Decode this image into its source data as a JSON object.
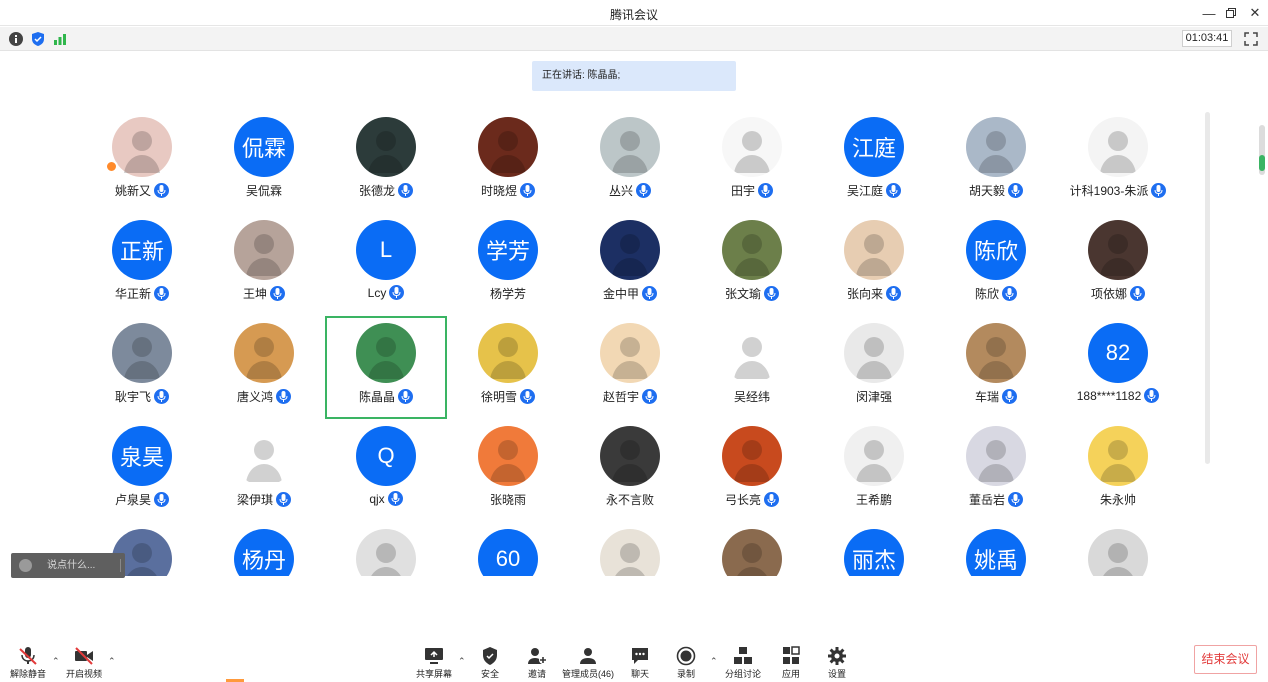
{
  "window": {
    "title": "腾讯会议"
  },
  "infobar": {
    "timer": "01:03:41"
  },
  "speaking": {
    "label": "正在讲话: 陈晶晶;"
  },
  "participants": [
    {
      "name": "姚新又",
      "avatar_text": "",
      "mic": true,
      "color": "#e8c9c2"
    },
    {
      "name": "吴侃霖",
      "avatar_text": "侃霖",
      "mic": false
    },
    {
      "name": "张德龙",
      "avatar_text": "",
      "mic": true,
      "color": "#2c3b3a"
    },
    {
      "name": "时晓煜",
      "avatar_text": "",
      "mic": true,
      "color": "#6b2a1c"
    },
    {
      "name": "丛兴",
      "avatar_text": "",
      "mic": true,
      "color": "#bcc6c8"
    },
    {
      "name": "田宇",
      "avatar_text": "",
      "mic": true,
      "color": "#f7f7f7"
    },
    {
      "name": "吴江庭",
      "avatar_text": "江庭",
      "mic": true
    },
    {
      "name": "胡天毅",
      "avatar_text": "",
      "mic": true,
      "color": "#aab8c8"
    },
    {
      "name": "计科1903-朱派",
      "avatar_text": "",
      "mic": true,
      "color": "#f4f4f4"
    },
    {
      "name": "华正新",
      "avatar_text": "正新",
      "mic": true
    },
    {
      "name": "王坤",
      "avatar_text": "",
      "mic": true,
      "color": "#b6a39a"
    },
    {
      "name": "Lcy",
      "avatar_text": "L",
      "mic": true
    },
    {
      "name": "杨学芳",
      "avatar_text": "学芳",
      "mic": false
    },
    {
      "name": "金中甲",
      "avatar_text": "",
      "mic": true,
      "color": "#1c2f63"
    },
    {
      "name": "张文瑜",
      "avatar_text": "",
      "mic": true,
      "color": "#6c7f4a"
    },
    {
      "name": "张向来",
      "avatar_text": "",
      "mic": true,
      "color": "#e7cdb2"
    },
    {
      "name": "陈欣",
      "avatar_text": "陈欣",
      "mic": true
    },
    {
      "name": "项依娜",
      "avatar_text": "",
      "mic": true,
      "color": "#4a3630"
    },
    {
      "name": "耿宇飞",
      "avatar_text": "",
      "mic": true,
      "color": "#7d8a9c"
    },
    {
      "name": "唐义鸿",
      "avatar_text": "",
      "mic": true,
      "color": "#d69a52"
    },
    {
      "name": "陈晶晶",
      "avatar_text": "",
      "mic": true,
      "color": "#3f8f54"
    },
    {
      "name": "徐明雪",
      "avatar_text": "",
      "mic": true,
      "color": "#e6c24a"
    },
    {
      "name": "赵哲宇",
      "avatar_text": "",
      "mic": true,
      "color": "#f2d8b4"
    },
    {
      "name": "吴经纬",
      "avatar_text": "",
      "mic": false,
      "color": "#ffffff"
    },
    {
      "name": "闵津强",
      "avatar_text": "",
      "mic": false,
      "color": "#e9e9e9"
    },
    {
      "name": "车瑞",
      "avatar_text": "",
      "mic": true,
      "color": "#b38a5e"
    },
    {
      "name": "188****1182",
      "avatar_text": "82",
      "mic": true
    },
    {
      "name": "卢泉昊",
      "avatar_text": "泉昊",
      "mic": true
    },
    {
      "name": "梁伊琪",
      "avatar_text": "",
      "mic": true,
      "color": "#ffffff"
    },
    {
      "name": "qjx",
      "avatar_text": "Q",
      "mic": true
    },
    {
      "name": "张晓雨",
      "avatar_text": "",
      "mic": false,
      "color": "#f07a3a"
    },
    {
      "name": "永不言败",
      "avatar_text": "",
      "mic": false,
      "color": "#3a3a3a"
    },
    {
      "name": "弓长亮",
      "avatar_text": "",
      "mic": true,
      "color": "#c84a1e"
    },
    {
      "name": "王希鹏",
      "avatar_text": "",
      "mic": false,
      "color": "#f0f0f0"
    },
    {
      "name": "董岳岩",
      "avatar_text": "",
      "mic": true,
      "color": "#d8d8e2"
    },
    {
      "name": "朱永帅",
      "avatar_text": "",
      "mic": false,
      "color": "#f5d25a"
    },
    {
      "name": "",
      "avatar_text": "",
      "mic": false,
      "color": "#5a6f9e"
    },
    {
      "name": "",
      "avatar_text": "杨丹",
      "mic": false
    },
    {
      "name": "",
      "avatar_text": "",
      "mic": false,
      "color": "#e0e0e0"
    },
    {
      "name": "",
      "avatar_text": "60",
      "mic": false
    },
    {
      "name": "",
      "avatar_text": "",
      "mic": false,
      "color": "#e8e2d8"
    },
    {
      "name": "",
      "avatar_text": "",
      "mic": false,
      "color": "#8a6a4e"
    },
    {
      "name": "",
      "avatar_text": "丽杰",
      "mic": false
    },
    {
      "name": "",
      "avatar_text": "姚禹",
      "mic": false
    },
    {
      "name": "",
      "avatar_text": "",
      "mic": false,
      "color": "#d9d9d9"
    }
  ],
  "active_speaker_index": 20,
  "chat": {
    "placeholder": "说点什么..."
  },
  "toolbar": {
    "unmute": "解除静音",
    "start_video": "开启视频",
    "share_screen": "共享屏幕",
    "security": "安全",
    "invite": "邀请",
    "members": "管理成员(46)",
    "chat": "聊天",
    "record": "录制",
    "breakout": "分组讨论",
    "apps": "应用",
    "settings": "设置",
    "end_meeting": "结束会议"
  },
  "colors": {
    "accent": "#0a6cf5",
    "active_border": "#3ab463",
    "end_red": "#e23a3a"
  }
}
